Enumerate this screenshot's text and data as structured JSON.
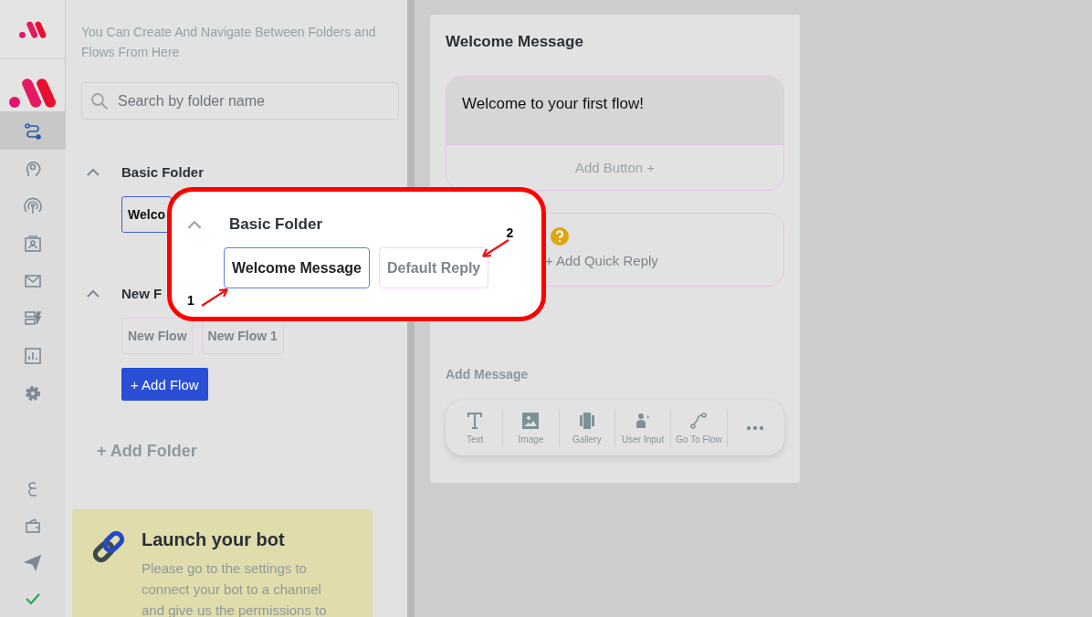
{
  "rail": {
    "items": [
      {
        "selected": true
      },
      {
        "selected": false
      },
      {
        "selected": false
      },
      {
        "selected": false
      },
      {
        "selected": false
      },
      {
        "selected": false
      },
      {
        "selected": false
      },
      {
        "selected": false
      }
    ],
    "bottom_items": [
      {
        "selected": false
      },
      {
        "selected": false
      },
      {
        "selected": false
      },
      {
        "selected": false
      }
    ]
  },
  "sidebar": {
    "intro": "You Can Create And Navigate Between Folders and Flows From Here",
    "search": {
      "placeholder": "Search by folder name"
    },
    "folders": [
      {
        "name": "Basic Folder",
        "expanded": true,
        "flows": [
          {
            "label": "Welco",
            "selected": true
          }
        ]
      },
      {
        "name": "New F",
        "expanded": true,
        "flows": [
          {
            "label": "New Flow",
            "selected": false
          },
          {
            "label": "New Flow 1",
            "selected": false
          }
        ],
        "add_flow": "+ Add Flow"
      }
    ],
    "add_folder": "+ Add Folder",
    "launch": {
      "title": "Launch your bot",
      "text": "Please go to the settings to connect your bot to a channel and give us the permissions to"
    }
  },
  "editor": {
    "title": "Welcome Message",
    "message": "Welcome to your first flow!",
    "add_button": "Add Button +",
    "quick_reply": "+ Add Quick Reply",
    "add_message": "Add Message",
    "tools": [
      {
        "label": "Text"
      },
      {
        "label": "Image"
      },
      {
        "label": "Gallery"
      },
      {
        "label": "User Input"
      },
      {
        "label": "Go To Flow"
      }
    ]
  },
  "callout": {
    "folder": "Basic Folder",
    "expanded": true,
    "flows": [
      {
        "label": "Welcome Message",
        "selected": true,
        "number": "1"
      },
      {
        "label": "Default Reply",
        "selected": false,
        "number": "2"
      }
    ]
  }
}
